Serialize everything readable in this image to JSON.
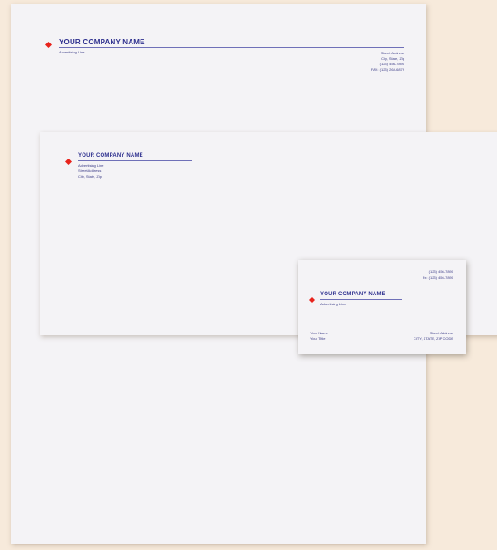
{
  "letterhead": {
    "company_name": "YOUR COMPANY NAME",
    "advertising_line": "Advertising Line",
    "address": [
      "Street Address",
      "City, State, Zip",
      "(123) 456-7890",
      "FAX: (123) 264-6879"
    ]
  },
  "envelope": {
    "company_name": "YOUR COMPANY NAME",
    "lines": [
      "Advertising Line",
      "StreetAddress",
      "City, State, Zip"
    ]
  },
  "business_card": {
    "phones": [
      "(123) 456-7890",
      "Fx: (123) 456-7890"
    ],
    "company_name": "YOUR COMPANY NAME",
    "advertising_line": "Advertising Line",
    "person": [
      "Your Name",
      "Your Title"
    ],
    "address": [
      "Street Address",
      "CITY, STATE, ZIP CODE"
    ]
  },
  "colors": {
    "ink": "#2d2f8e",
    "logo": "#e8231c",
    "paper": "#f4f3f6",
    "background": "#f7eadb"
  }
}
